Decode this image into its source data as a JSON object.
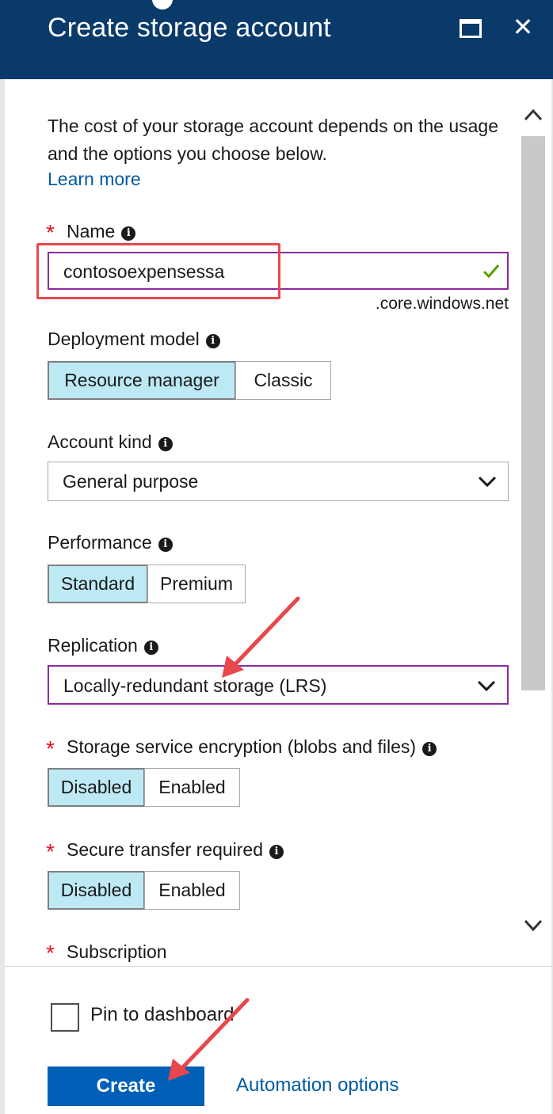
{
  "blade": {
    "title": "Create storage account",
    "maximize_icon": "maximize-icon",
    "close_icon": "close-icon",
    "close_glyph": "✕"
  },
  "intro": {
    "text": "The cost of your storage account depends on the usage and the options you choose below.",
    "learn_more": "Learn more"
  },
  "name": {
    "label": "Name",
    "required": true,
    "value": "contosoexpensessa",
    "suffix": ".core.windows.net",
    "valid": true
  },
  "deployment_model": {
    "label": "Deployment model",
    "options": [
      "Resource manager",
      "Classic"
    ],
    "selected": "Resource manager"
  },
  "account_kind": {
    "label": "Account kind",
    "value": "General purpose"
  },
  "performance": {
    "label": "Performance",
    "options": [
      "Standard",
      "Premium"
    ],
    "selected": "Standard"
  },
  "replication": {
    "label": "Replication",
    "value": "Locally-redundant storage (LRS)"
  },
  "encryption": {
    "label": "Storage service encryption (blobs and files)",
    "required": true,
    "options": [
      "Disabled",
      "Enabled"
    ],
    "selected": "Disabled"
  },
  "secure_transfer": {
    "label": "Secure transfer required",
    "required": true,
    "options": [
      "Disabled",
      "Enabled"
    ],
    "selected": "Disabled"
  },
  "subscription": {
    "label": "Subscription",
    "required": true
  },
  "footer": {
    "pin_label": "Pin to dashboard",
    "pinned": false,
    "create_label": "Create",
    "automation_label": "Automation options"
  },
  "glyphs": {
    "required_star": "*",
    "info": "i"
  },
  "colors": {
    "header_bg": "#0a3a6a",
    "primary_button": "#0060b7",
    "link": "#005ba1",
    "selected_segment": "#bde9f5",
    "focus_border": "#8a2c9e",
    "annotation_red": "#e8474c",
    "required_star": "#e81123",
    "valid_check": "#5aa000"
  }
}
